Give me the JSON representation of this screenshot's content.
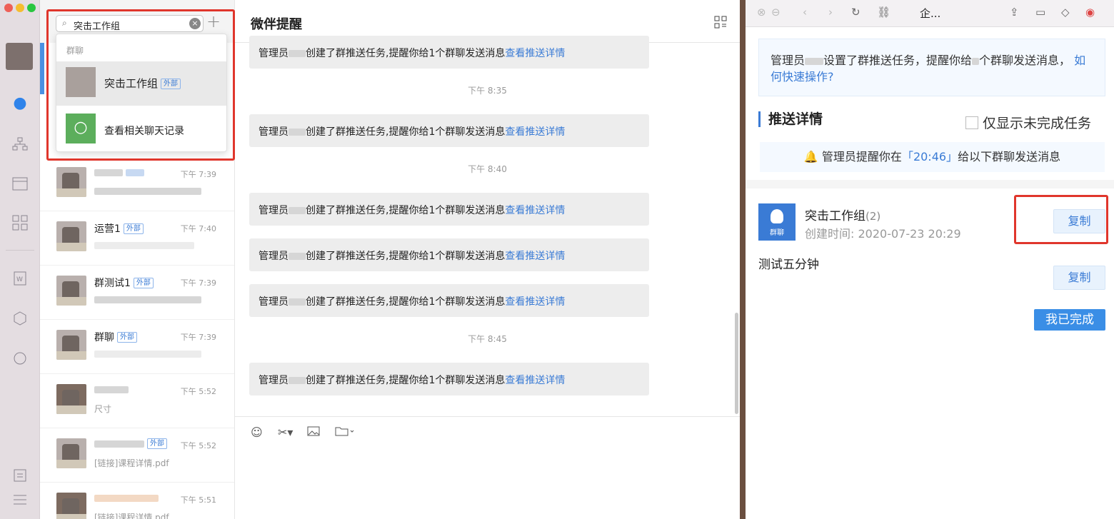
{
  "search": {
    "query": "突击工作组"
  },
  "dropdown": {
    "section": "群聊",
    "group_name": "突击工作组",
    "group_tag": "外部",
    "search_history": "查看相关聊天记录"
  },
  "rows": [
    {
      "name": "",
      "tag": "",
      "time": "下午 7:39",
      "preview": ""
    },
    {
      "name": "运营1",
      "tag": "外部",
      "time": "下午 7:40",
      "preview": ""
    },
    {
      "name": "群测试1",
      "tag": "外部",
      "time": "下午 7:39",
      "preview": ""
    },
    {
      "name": "群聊",
      "tag": "外部",
      "time": "下午 7:39",
      "preview": ""
    },
    {
      "name": "",
      "tag": "",
      "time": "下午 5:52",
      "preview": "尺寸"
    },
    {
      "name": "",
      "tag": "外部",
      "time": "下午 5:52",
      "preview": "[链接]课程详情.pdf"
    },
    {
      "name": "",
      "tag": "",
      "time": "下午 5:51",
      "preview": "[链接]课程详情.pdf"
    }
  ],
  "chat": {
    "title": "微伴提醒",
    "msg_prefix": "管理员",
    "msg_body": "创建了群推送任务,提醒你给1个群聊发送消息",
    "msg_link": "查看推送详情",
    "times": [
      "下午 8:35",
      "下午 8:40",
      "下午 8:45"
    ]
  },
  "panel": {
    "title_short": "企...",
    "notice_a": "管理员",
    "notice_b": "设置了群推送任务，提醒你给",
    "notice_c": "个群聊发送消息，",
    "notice_link": "如何快速操作?",
    "section": "推送详情",
    "checkbox_label": "仅显示未完成任务",
    "remind_a": "管理员提醒你在",
    "remind_time": "「20:46」",
    "remind_b": "给以下群聊发送消息",
    "group_name": "突击工作组",
    "group_count": "(2)",
    "group_icon_label": "群聊",
    "created": "创建时间:  2020-07-23 20:29",
    "copy": "复制",
    "content": "测试五分钟",
    "done": "我已完成"
  }
}
